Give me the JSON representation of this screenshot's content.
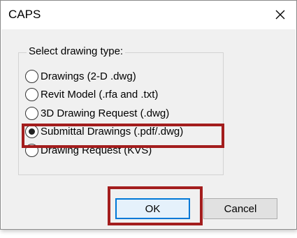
{
  "window": {
    "title": "CAPS"
  },
  "group": {
    "legend": "Select drawing type:",
    "options": [
      {
        "label": "Drawings (2-D .dwg)",
        "selected": false
      },
      {
        "label": "Revit Model (.rfa and .txt)",
        "selected": false
      },
      {
        "label": "3D Drawing Request (.dwg)",
        "selected": false
      },
      {
        "label": "Submittal Drawings (.pdf/.dwg)",
        "selected": true
      },
      {
        "label": "Drawing Request (KVS)",
        "selected": false
      }
    ]
  },
  "buttons": {
    "ok_label": "OK",
    "cancel_label": "Cancel"
  },
  "colors": {
    "highlight": "#a31d1d",
    "default_button_border": "#0078d7",
    "dialog_background": "#f0f0f0"
  }
}
